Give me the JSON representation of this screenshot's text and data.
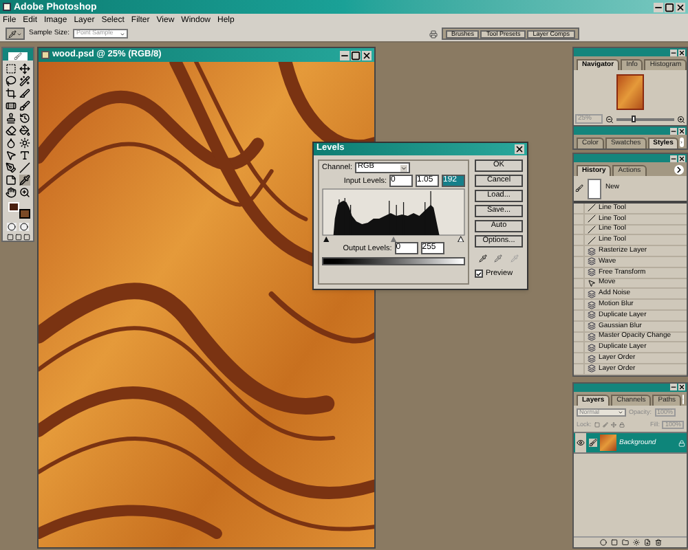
{
  "app": {
    "title": "Adobe Photoshop"
  },
  "menu": [
    "File",
    "Edit",
    "Image",
    "Layer",
    "Select",
    "Filter",
    "View",
    "Window",
    "Help"
  ],
  "options_bar": {
    "sample_size_label": "Sample Size:",
    "sample_size": "Point Sample",
    "palette_tabs": [
      "Brushes",
      "Tool Presets",
      "Layer Comps"
    ]
  },
  "document": {
    "title": "wood.psd @ 25% (RGB/8)"
  },
  "levels": {
    "title": "Levels",
    "channel_label": "Channel:",
    "channel": "RGB",
    "input_label": "Input Levels:",
    "input": [
      {
        "value": "0",
        "selected": false
      },
      {
        "value": "1.05",
        "selected": false
      },
      {
        "value": "192",
        "selected": true
      }
    ],
    "output_label": "Output Levels:",
    "output": [
      "0",
      "255"
    ],
    "buttons": [
      "OK",
      "Cancel",
      "Load...",
      "Save...",
      "Auto",
      "Options..."
    ],
    "preview": {
      "label": "Preview",
      "checked": true
    }
  },
  "navigator": {
    "tabs": [
      {
        "label": "Navigator",
        "selected": true
      },
      {
        "label": "Info",
        "selected": false
      },
      {
        "label": "Histogram",
        "selected": false
      }
    ],
    "zoom": "25%",
    "zoom_slider": {
      "level": 0.3
    }
  },
  "color_panel": {
    "tabs": [
      {
        "label": "Color",
        "selected": false
      },
      {
        "label": "Swatches",
        "selected": false
      },
      {
        "label": "Styles",
        "selected": true
      }
    ]
  },
  "history": {
    "tabs": [
      {
        "label": "History",
        "selected": true
      },
      {
        "label": "Actions",
        "selected": false
      }
    ],
    "snapshot": "New",
    "items": [
      {
        "label": "Line Tool",
        "kind": "line"
      },
      {
        "label": "Line Tool",
        "kind": "line"
      },
      {
        "label": "Line Tool",
        "kind": "line"
      },
      {
        "label": "Line Tool",
        "kind": "line"
      },
      {
        "label": "Rasterize Layer",
        "kind": "layer"
      },
      {
        "label": "Wave",
        "kind": "layer"
      },
      {
        "label": "Free Transform",
        "kind": "layer"
      },
      {
        "label": "Move",
        "kind": "move"
      },
      {
        "label": "Add Noise",
        "kind": "layer"
      },
      {
        "label": "Motion Blur",
        "kind": "layer"
      },
      {
        "label": "Duplicate Layer",
        "kind": "layer"
      },
      {
        "label": "Gaussian Blur",
        "kind": "layer"
      },
      {
        "label": "Master Opacity Change",
        "kind": "layer"
      },
      {
        "label": "Duplicate Layer",
        "kind": "layer"
      },
      {
        "label": "Layer Order",
        "kind": "layer"
      },
      {
        "label": "Layer Order",
        "kind": "layer"
      }
    ]
  },
  "layers": {
    "tabs": [
      {
        "label": "Layers",
        "selected": true
      },
      {
        "label": "Channels",
        "selected": false
      },
      {
        "label": "Paths",
        "selected": false
      }
    ],
    "blend_mode": "Normal",
    "opacity_label": "Opacity:",
    "opacity": "100%",
    "lock_label": "Lock:",
    "fill_label": "Fill:",
    "fill": "100%",
    "list": [
      {
        "name": "Background",
        "selected": true,
        "visible": true
      }
    ]
  }
}
